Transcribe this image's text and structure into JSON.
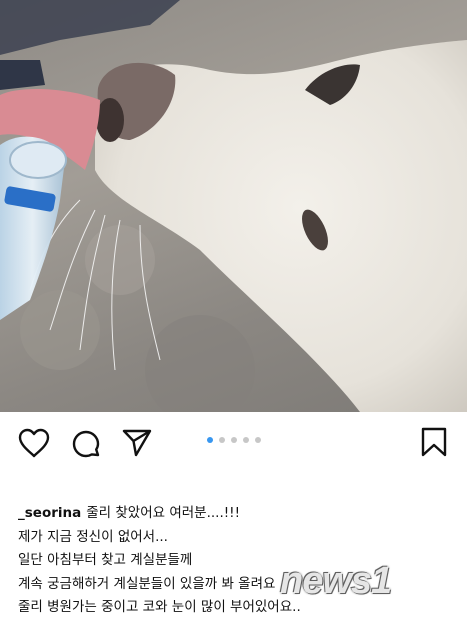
{
  "post": {
    "photo_alt": "",
    "carousel": {
      "total": 5,
      "active_index": 0
    }
  },
  "actions": {
    "like_icon": "heart-icon",
    "comment_icon": "comment-icon",
    "share_icon": "send-icon",
    "save_icon": "bookmark-icon"
  },
  "caption": {
    "username": "_seorina",
    "first_line": "줄리 찾았어요 여러분....!!!",
    "lines": [
      "제가 지금 정신이 없어서...",
      "일단 아침부터 찾고 계실분들께",
      "계속 궁금해하거 계실분들이 있을까 봐 올려요",
      "줄리 병원가는 중이고 코와 눈이 많이 부어있어요.."
    ]
  },
  "watermark": {
    "text": "news1"
  },
  "colors": {
    "accent": "#3897f0",
    "dot_inactive": "#c7c7c7",
    "text": "#111111"
  }
}
